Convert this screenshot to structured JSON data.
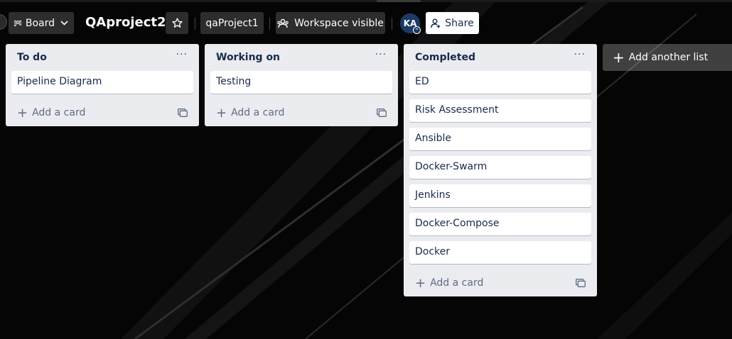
{
  "header": {
    "view_label": "Board",
    "board_title": "QAproject2",
    "workspace_label": "qaProject1",
    "visibility_label": "Workspace visible",
    "avatar_initials": "KA",
    "share_label": "Share"
  },
  "lists": [
    {
      "title": "To do",
      "cards": [
        "Pipeline Diagram"
      ],
      "add_card_label": "Add a card"
    },
    {
      "title": "Working on",
      "cards": [
        "Testing"
      ],
      "add_card_label": "Add a card"
    },
    {
      "title": "Completed",
      "cards": [
        "ED",
        "Risk Assessment",
        "Ansible",
        "Docker-Swarm",
        "Jenkins",
        "Docker-Compose",
        "Docker"
      ],
      "add_card_label": "Add a card"
    }
  ],
  "add_list_label": "Add another list",
  "icons": {
    "board": "board-icon",
    "star": "star-icon",
    "visibility": "workspace-icon",
    "share": "add-member-icon",
    "list_menu": "more-icon",
    "template": "template-icon"
  },
  "colors": {
    "background": "#050505",
    "list_bg": "#ebecf0",
    "card_bg": "#ffffff",
    "text": "#172b4d"
  }
}
